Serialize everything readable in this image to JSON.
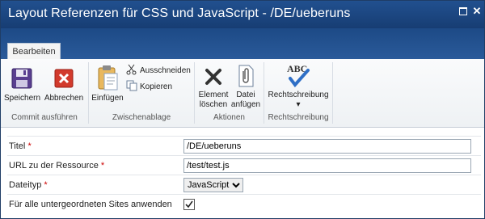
{
  "window": {
    "title": "Layout Referenzen für CSS und JavaScript - /DE/ueberuns"
  },
  "tabs": [
    {
      "label": "Bearbeiten"
    }
  ],
  "ribbon": {
    "commit": {
      "save": "Speichern",
      "cancel": "Abbrechen",
      "group": "Commit ausführen"
    },
    "clipboard": {
      "paste": "Einfügen",
      "cut": "Ausschneiden",
      "copy": "Kopieren",
      "group": "Zwischenablage"
    },
    "actions": {
      "delete_line1": "Element",
      "delete_line2": "löschen",
      "attach_line1": "Datei",
      "attach_line2": "anfügen",
      "group": "Aktionen"
    },
    "spelling": {
      "button": "Rechtschreibung",
      "icon_text": "ABC",
      "group": "Rechtschreibung"
    }
  },
  "form": {
    "title": {
      "label": "Titel",
      "required": "*",
      "value": "/DE/ueberuns"
    },
    "url": {
      "label": "URL zu der Ressource",
      "required": "*",
      "value": "/test/test.js"
    },
    "filetype": {
      "label": "Dateityp",
      "required": "*",
      "selected": "JavaScript"
    },
    "subsites": {
      "label": "Für alle untergeordneten Sites anwenden",
      "checked": true
    }
  }
}
